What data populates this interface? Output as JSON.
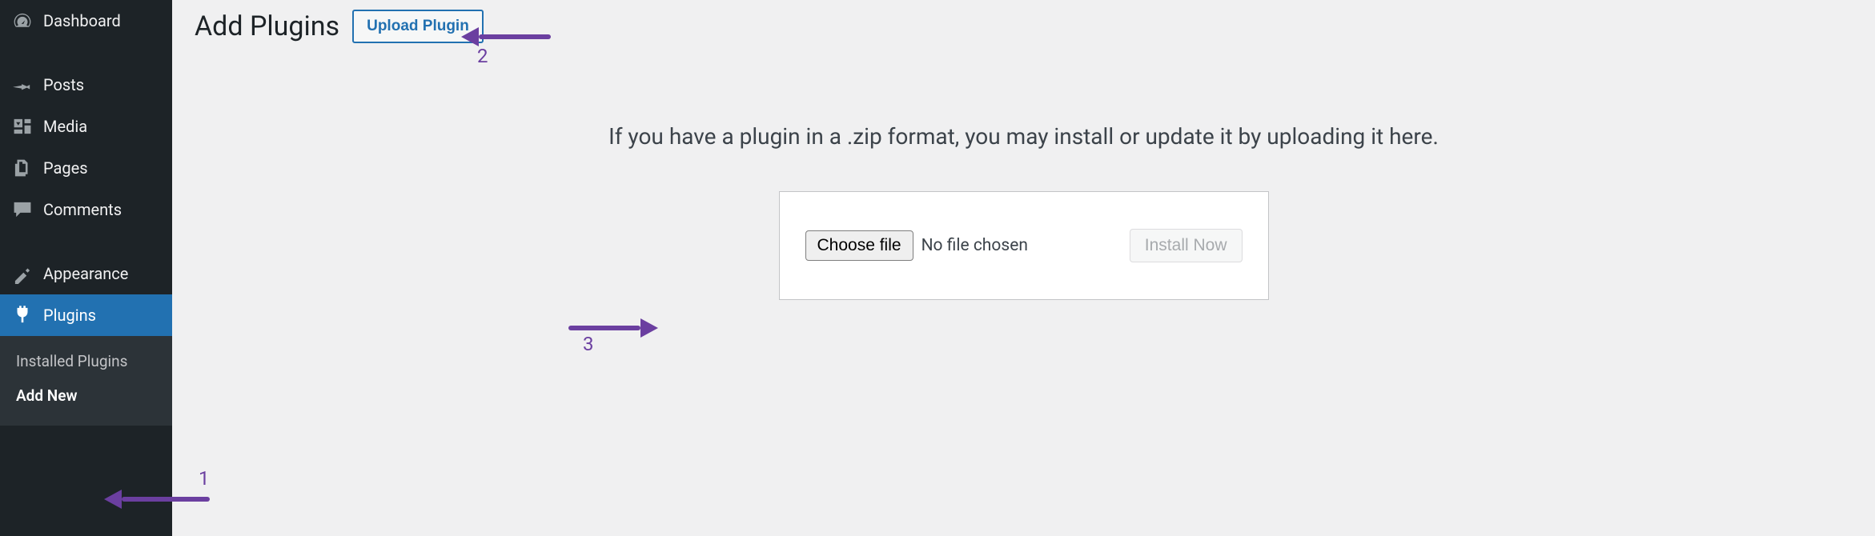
{
  "sidebar": {
    "items": [
      {
        "label": "Dashboard"
      },
      {
        "label": "Posts"
      },
      {
        "label": "Media"
      },
      {
        "label": "Pages"
      },
      {
        "label": "Comments"
      },
      {
        "label": "Appearance"
      },
      {
        "label": "Plugins"
      }
    ],
    "submenu": [
      {
        "label": "Installed Plugins"
      },
      {
        "label": "Add New"
      }
    ]
  },
  "page": {
    "title": "Add Plugins",
    "upload_button": "Upload Plugin",
    "instruction": "If you have a plugin in a .zip format, you may install or update it by uploading it here.",
    "choose_file": "Choose file",
    "no_file": "No file chosen",
    "install_now": "Install Now"
  },
  "annotations": {
    "n1": "1",
    "n2": "2",
    "n3": "3"
  }
}
